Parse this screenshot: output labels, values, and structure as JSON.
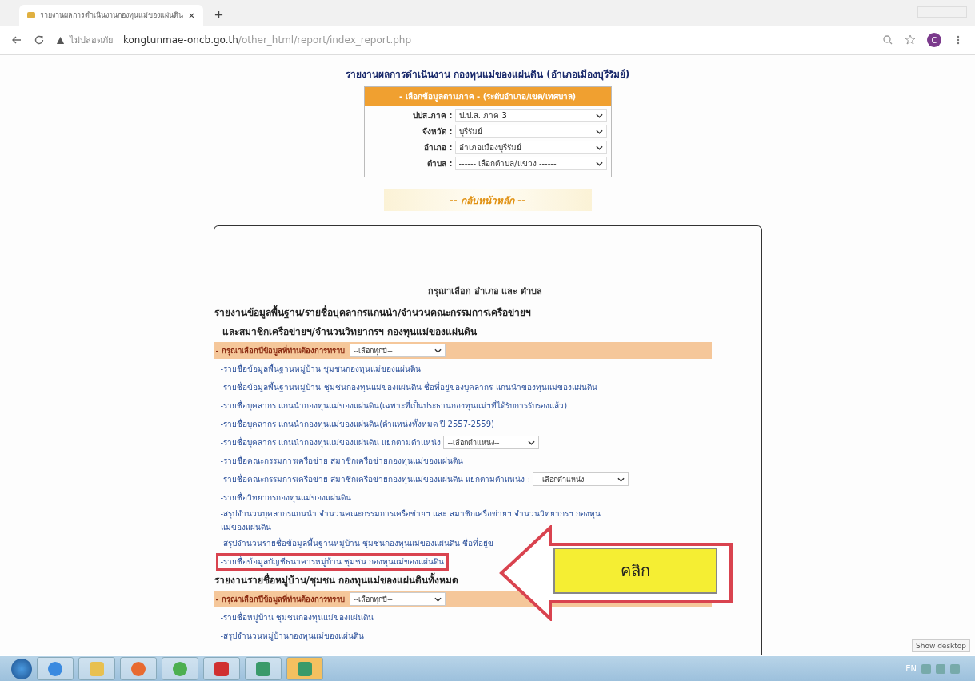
{
  "browser": {
    "tab_title": "รายงานผลการดำเนินงานกองทุนแม่ของแผ่นดิน",
    "security_label": "ไม่ปลอดภัย",
    "url_host": "kongtunmae-oncb.go.th",
    "url_path": "/other_html/report/index_report.php",
    "profile_initial": "C"
  },
  "page": {
    "title": "รายงานผลการดำเนินงาน กองทุนแม่ของแผ่นดิน (อำเภอเมืองบุรีรัมย์)",
    "filter_panel": {
      "header": "- เลือกข้อมูลตามภาค - (ระดับอำเภอ/เขต/เทศบาล)",
      "fields": [
        {
          "label": "ปปส.ภาค :",
          "value": "ป.ป.ส. ภาค 3"
        },
        {
          "label": "จังหวัด :",
          "value": "บุรีรัมย์"
        },
        {
          "label": "อำเภอ :",
          "value": "อำเภอเมืองบุรีรัมย์"
        },
        {
          "label": "ตำบล :",
          "value": "------ เลือกตำบล/แขวง ------"
        }
      ]
    },
    "back_button": "-- กลับหน้าหลัก --",
    "card": {
      "prompt": "กรุณาเลือก อำเภอ และ ตำบล",
      "sections": [
        {
          "heading": [
            "รายงานข้อมูลพื้นฐาน/รายชื่อบุคลากรแกนนำ/จำนวนคณะกรรมการเครือข่ายฯ",
            "และสมาชิกเครือข่ายฯ/จำนวนวิทยากรฯ กองทุนแม่ของแผ่นดิน"
          ],
          "year_label": "- กรุณาเลือกปีข้อมูลที่ท่านต้องการทราบ",
          "year_value": "--เลือกทุกปี--",
          "items": [
            {
              "kind": "link",
              "text": "-รายชื่อข้อมูลพื้นฐานหมู่บ้าน ชุมชนกองทุนแม่ของแผ่นดิน",
              "highlighted": false
            },
            {
              "kind": "link",
              "text": "-รายชื่อข้อมูลพื้นฐานหมู่บ้าน-ชุมชนกองทุนแม่ของแผ่นดิน ชื่อที่อยู่ของบุคลากร-แกนนำของทุนแม่ของแผ่นดิน",
              "highlighted": false
            },
            {
              "kind": "link",
              "text": "-รายชื่อบุคลากร แกนนำกองทุนแม่ของแผ่นดิน(เฉพาะที่เป็นประธานกองทุนแม่ฯที่ได้รับการรับรองแล้ว)",
              "highlighted": false
            },
            {
              "kind": "link",
              "text": "-รายชื่อบุคลากร แกนนำกองทุนแม่ของแผ่นดิน(ตำแหน่งทั้งหมด ปี 2557-2559)",
              "highlighted": false
            },
            {
              "kind": "link_select",
              "text": "-รายชื่อบุคลากร แกนนำกองทุนแม่ของแผ่นดิน แยกตามตำแหน่ง",
              "select": "--เลือกตำแหน่ง--",
              "highlighted": false
            },
            {
              "kind": "link",
              "text": "-รายชื่อคณะกรรมการเครือข่าย สมาชิกเครือข่ายกองทุนแม่ของแผ่นดิน",
              "highlighted": false
            },
            {
              "kind": "link_select",
              "text": "-รายชื่อคณะกรรมการเครือข่าย สมาชิกเครือข่ายกองทุนแม่ของแผ่นดิน แยกตามตำแหน่ง :",
              "select": "--เลือกตำแหน่ง--",
              "highlighted": false
            },
            {
              "kind": "link",
              "text": "-รายชื่อวิทยากรกองทุนแม่ของแผ่นดิน",
              "highlighted": false
            },
            {
              "kind": "link",
              "text": "-สรุปจำนวนบุคลากรแกนนำ จำนวนคณะกรรมการเครือข่ายฯ และ สมาชิกเครือข่ายฯ จำนวนวิทยากรฯ กองทุนแม่ของแผ่นดิน",
              "highlighted": false
            },
            {
              "kind": "link",
              "text": "-สรุปจำนวนรายชื่อข้อมูลพื้นฐานหมู่บ้าน ชุมชนกองทุนแม่ของแผ่นดิน ชื่อที่อยู่ข",
              "highlighted": false
            },
            {
              "kind": "link",
              "text": "-รายชื่อข้อมูลบัญชีธนาคารหมู่บ้าน ชุมชน กองทุนแม่ของแผ่นดิน",
              "highlighted": true
            }
          ]
        },
        {
          "heading": [
            "รายงานรายชื่อหมู่บ้าน/ชุมชน กองทุนแม่ของแผ่นดินทั้งหมด"
          ],
          "year_label": "- กรุณาเลือกปีข้อมูลที่ท่านต้องการทราบ",
          "year_value": "--เลือกทุกปี--",
          "items": [
            {
              "kind": "link",
              "text": "-รายชื่อหมู่บ้าน ชุมชนกองทุนแม่ของแผ่นดิน",
              "highlighted": false
            },
            {
              "kind": "link",
              "text": "-สรุปจำนวนหมู่บ้านกองทุนแม่ของแผ่นดิน",
              "highlighted": false
            }
          ]
        }
      ]
    },
    "callout": {
      "label": "คลิก"
    }
  },
  "taskbar": {
    "tooltip": "Show desktop",
    "language": "EN"
  }
}
